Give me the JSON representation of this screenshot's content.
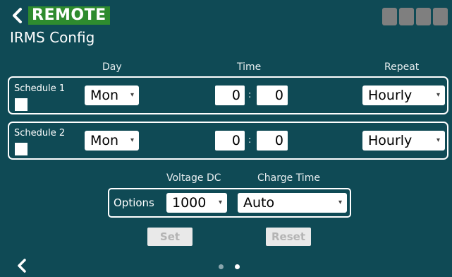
{
  "header": {
    "badge": "REMOTE",
    "title": "IRMS Config",
    "icons": [
      "chevron-left-icon",
      "signal-bars-icon"
    ]
  },
  "columns": {
    "day": "Day",
    "time": "Time",
    "repeat": "Repeat"
  },
  "schedules": [
    {
      "label": "Schedule 1",
      "checked": false,
      "day": "Mon",
      "hour": "0",
      "minute": "0",
      "repeat": "Hourly"
    },
    {
      "label": "Schedule 2",
      "checked": false,
      "day": "Mon",
      "hour": "0",
      "minute": "0",
      "repeat": "Hourly"
    }
  ],
  "time_separator": ":",
  "options": {
    "label": "Options",
    "voltage_header": "Voltage DC",
    "charge_header": "Charge Time",
    "voltage": "1000",
    "charge_time": "Auto"
  },
  "buttons": {
    "set": "Set",
    "reset": "Reset"
  },
  "pager": {
    "pages": 2,
    "current": 2
  },
  "colors": {
    "background": "#0f4a55",
    "badge": "#2e8b2e",
    "status_bars": "#7f7f7f",
    "disabled_button_bg": "#e9e9e9",
    "disabled_button_text": "#b4b4b4"
  }
}
